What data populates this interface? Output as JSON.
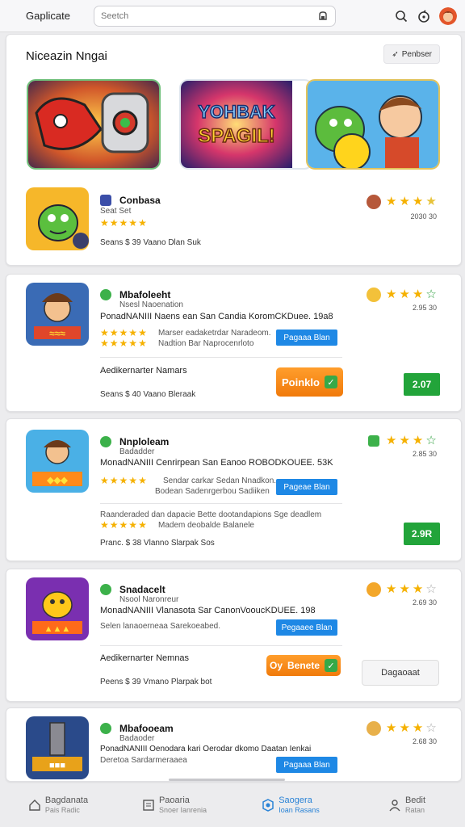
{
  "header": {
    "title": "Gaplicate",
    "search_placeholder": "Seetch"
  },
  "featured": {
    "title": "Niceazin Nngai",
    "action_label": "Penbser",
    "banner_text": [
      "YOHBAK",
      "SPAGIL!"
    ]
  },
  "apps": [
    {
      "name": "Conbasa",
      "sub": "Seat Set",
      "meta": "Seans   $ 39   Vaano Dlan Suk",
      "count": "2030 30"
    },
    {
      "name": "Mbafoleeht",
      "sub": "Nsesl Naoenation",
      "line": "PonadNANIII Naens ean San Candia KoromCKDuee. 19a8",
      "desc1": "Marser eadaketrdar Naradeom.",
      "desc2": "Nadtion Bar Naprocenrloto",
      "button": "Pagaaa Blan",
      "extra_title": "Aedikernarter Namars",
      "extra_sub": "Seans   $ 40   Vaano Bleraak",
      "install": "Poinklo",
      "price": "2.07",
      "count": "2.95 30"
    },
    {
      "name": "Nnploleam",
      "sub": "Badadder",
      "line": "MonadNANIII Cenrirpean San Eanoo ROBODKOUEE. 53K",
      "desc1": "Sendar carkar Sedan Nnadkon.",
      "desc2": "Bodean Sadenrgerbou Sadiiken",
      "button": "Pageae Blan",
      "extra_title": "Raanderaded dan dapacie Bette dootandapions  Sge  deadlem",
      "extra_sub": "Madem deobalde Balanele",
      "meta": "Pranc.   $ 38   Vlanno Slarpak  Sos",
      "price": "2.9R",
      "count": "2.85 30"
    },
    {
      "name": "Snadacelt",
      "sub": "Nsool Naronreur",
      "line": "MonadNANIII Vlanasota Sar CanonVooucKDUEE. 198",
      "desc1": "Selen lanaoerneaa Sarekoeabed.",
      "button": "Pegaaee Blan",
      "extra_title": "Aedikernarter Nemnas",
      "extra_sub": "Peens   $ 39   Vmano Plarpak  bot",
      "install": "Benete",
      "install_prefix": "Oy",
      "secondary": "Dagaoaat",
      "count": "2.69 30"
    },
    {
      "name": "Mbafooeam",
      "sub": "Badaoder",
      "line": "PonadNANIII Oenodara kari Oerodar dkomo Daatan Ienkai",
      "desc1": "Deretoa Sardarmeraaea",
      "button": "Pagaaa Blan",
      "count": "2.68 30"
    }
  ],
  "nav": [
    {
      "label": "Bagdanata",
      "sub": "Pais  Radic"
    },
    {
      "label": "Paoaria",
      "sub": "Snoer Ianrenia"
    },
    {
      "label": "Saogera",
      "sub": "Ioan  Rasans"
    },
    {
      "label": "Bedit",
      "sub": "Ratan"
    }
  ],
  "colors": {
    "primary_blue": "#1e88e5",
    "green": "#22a43a",
    "orange": "#f58a14",
    "star": "#f5b100"
  }
}
